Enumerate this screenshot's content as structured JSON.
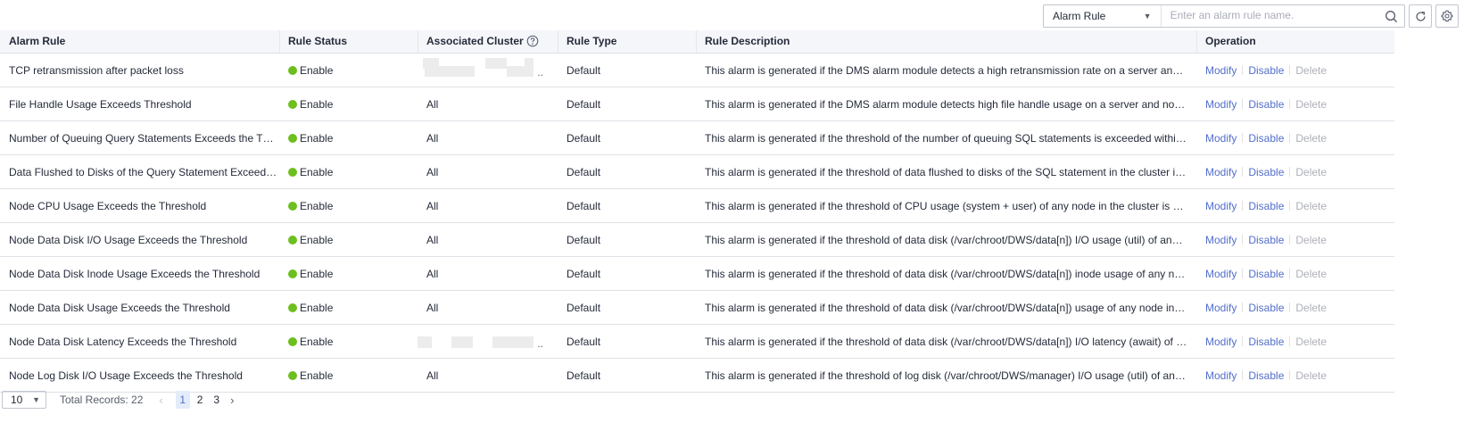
{
  "toolbar": {
    "filter_select": "Alarm Rule",
    "search_placeholder": "Enter an alarm rule name."
  },
  "columns": {
    "alarm_rule": "Alarm Rule",
    "rule_status": "Rule Status",
    "associated_cluster": "Associated Cluster",
    "rule_type": "Rule Type",
    "rule_description": "Rule Description",
    "operation": "Operation"
  },
  "operations": {
    "modify": "Modify",
    "disable": "Disable",
    "delete": "Delete"
  },
  "rows": [
    {
      "name": "TCP retransmission after packet loss",
      "status": "Enable",
      "cluster": "",
      "type": "Default",
      "description": "This alarm is generated if the DMS alarm module detects a high retransmission rate on a server and no alarm suppression ..."
    },
    {
      "name": "File Handle Usage Exceeds Threshold",
      "status": "Enable",
      "cluster": "All",
      "type": "Default",
      "description": "This alarm is generated if the DMS alarm module detects high file handle usage on a server and no alarm suppression ..."
    },
    {
      "name": "Number of Queuing Query Statements Exceeds the Threshold",
      "status": "Enable",
      "cluster": "All",
      "type": "Default",
      "description": "This alarm is generated if the threshold of the number of queuing SQL statements is exceeded within the specified p..."
    },
    {
      "name": "Data Flushed to Disks of the Query Statement Exceeds the T...",
      "status": "Enable",
      "cluster": "All",
      "type": "Default",
      "description": "This alarm is generated if the threshold of data flushed to disks of the SQL statement in the cluster is exceeded withi..."
    },
    {
      "name": "Node CPU Usage Exceeds the Threshold",
      "status": "Enable",
      "cluster": "All",
      "type": "Default",
      "description": "This alarm is generated if the threshold of CPU usage (system + user) of any node in the cluster is exceeded within t..."
    },
    {
      "name": "Node Data Disk I/O Usage Exceeds the Threshold",
      "status": "Enable",
      "cluster": "All",
      "type": "Default",
      "description": "This alarm is generated if the threshold of data disk (/var/chroot/DWS/data[n]) I/O usage (util) of any node in the clust..."
    },
    {
      "name": "Node Data Disk Inode Usage Exceeds the Threshold",
      "status": "Enable",
      "cluster": "All",
      "type": "Default",
      "description": "This alarm is generated if the threshold of data disk (/var/chroot/DWS/data[n]) inode usage of any node in the cluster ..."
    },
    {
      "name": "Node Data Disk Usage Exceeds the Threshold",
      "status": "Enable",
      "cluster": "All",
      "type": "Default",
      "description": "This alarm is generated if the threshold of data disk (/var/chroot/DWS/data[n]) usage of any node in the cluster is exc..."
    },
    {
      "name": "Node Data Disk Latency Exceeds the Threshold",
      "status": "Enable",
      "cluster": "",
      "type": "Default",
      "description": "This alarm is generated if the threshold of data disk (/var/chroot/DWS/data[n]) I/O latency (await) of any node in the c..."
    },
    {
      "name": "Node Log Disk I/O Usage Exceeds the Threshold",
      "status": "Enable",
      "cluster": "All",
      "type": "Default",
      "description": "This alarm is generated if the threshold of log disk (/var/chroot/DWS/manager) I/O usage (util) of any node in the clus..."
    }
  ],
  "pagination": {
    "page_size": "10",
    "total_label": "Total Records: 22",
    "pages": [
      "1",
      "2",
      "3"
    ],
    "current_page": "1"
  },
  "colors": {
    "accent": "#526ecc",
    "status_enabled": "#6cbf1e",
    "header_bg": "#f4f6fa"
  }
}
